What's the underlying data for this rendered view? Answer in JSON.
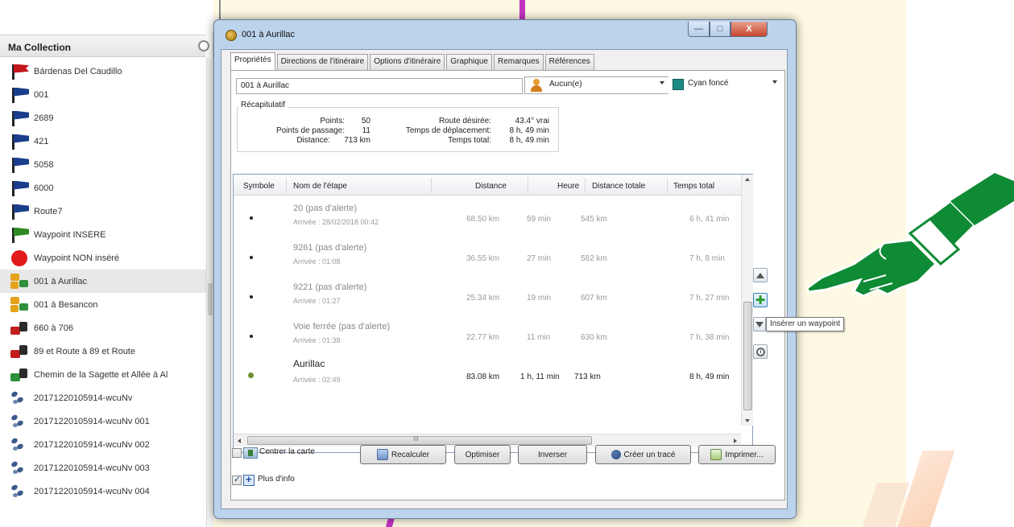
{
  "collection": {
    "header": "Ma Collection",
    "items": [
      {
        "label": "Bárdenas Del Caudillo",
        "icon": "red-flag-icon"
      },
      {
        "label": "001",
        "icon": "blue-flag-icon"
      },
      {
        "label": "2689",
        "icon": "blue-flag-icon"
      },
      {
        "label": "421",
        "icon": "blue-flag-icon"
      },
      {
        "label": "5058",
        "icon": "blue-flag-icon"
      },
      {
        "label": "6000",
        "icon": "blue-flag-icon"
      },
      {
        "label": "Route7",
        "icon": "blue-flag-icon"
      },
      {
        "label": "Waypoint INSERE",
        "icon": "green-flag-icon"
      },
      {
        "label": "Waypoint NON inséré",
        "icon": "red-dot-icon"
      },
      {
        "label": "001 à Aurillac",
        "icon": "route-yellow-icon"
      },
      {
        "label": "001 à Besancon",
        "icon": "route-yellow-icon"
      },
      {
        "label": "660 à 706",
        "icon": "route-red-icon"
      },
      {
        "label": "89 et Route à 89 et Route",
        "icon": "route-red-icon"
      },
      {
        "label": "Chemin de la Sagette et Allée à Al",
        "icon": "route-green-icon"
      },
      {
        "label": "20171220105914-wcuNv",
        "icon": "track-icon"
      },
      {
        "label": "20171220105914-wcuNv 001",
        "icon": "track-icon"
      },
      {
        "label": "20171220105914-wcuNv 002",
        "icon": "track-icon"
      },
      {
        "label": "20171220105914-wcuNv 003",
        "icon": "track-icon"
      },
      {
        "label": "20171220105914-wcuNv 004",
        "icon": "track-icon"
      }
    ]
  },
  "dialog": {
    "title": "001 à Aurillac",
    "window_controls": {
      "minimize": "—",
      "maximize": "□",
      "close": "X"
    },
    "tabs": [
      "Propriétés",
      "Directions de l'itinéraire",
      "Options d'itinéraire",
      "Graphique",
      "Remarques",
      "Références"
    ],
    "name_value": "001 à Aurillac",
    "assign_value": "Aucun(e)",
    "color_value": "Cyan foncé",
    "colors": {
      "accent": "#1c8a83"
    },
    "summary": {
      "title": "Récapitulatif",
      "points_label": "Points:",
      "points_value": "50",
      "waypoints_label": "Points de passage:",
      "waypoints_value": "11",
      "distance_label": "Distance:",
      "distance_value": "713 km",
      "route_label": "Route désirée:",
      "route_value": "43.4° vrai",
      "travel_label": "Temps de déplacement:",
      "travel_value": "8 h, 49 min",
      "total_label": "Temps total:",
      "total_value": "8 h, 49 min"
    },
    "table": {
      "headers": [
        "Symbole",
        "Nom de l'étape",
        "Distance",
        "Heure",
        "Distance totale",
        "Temps total"
      ],
      "rows": [
        {
          "name": "20 (pas d'alerte)",
          "arrival": "Arrivée : 28/02/2018 00:42",
          "distance": "68.50 km",
          "time": "59 min",
          "total_distance": "545 km",
          "total_time": "6 h, 41 min"
        },
        {
          "name": "9261 (pas d'alerte)",
          "arrival": "Arrivée : 01:08",
          "distance": "36.55 km",
          "time": "27 min",
          "total_distance": "582 km",
          "total_time": "7 h, 8 min"
        },
        {
          "name": "9221 (pas d'alerte)",
          "arrival": "Arrivée : 01:27",
          "distance": "25.34 km",
          "time": "19 min",
          "total_distance": "607 km",
          "total_time": "7 h, 27 min"
        },
        {
          "name": "Voie ferrée (pas d'alerte)",
          "arrival": "Arrivée : 01:38",
          "distance": "22.77 km",
          "time": "11 min",
          "total_distance": "630 km",
          "total_time": "7 h, 38 min"
        },
        {
          "name": "Aurillac",
          "arrival": "Arrivée : 02:49",
          "distance": "83.08 km",
          "time": "1 h, 11 min",
          "total_distance": "713 km",
          "total_time": "8 h, 49 min"
        }
      ]
    },
    "scroll_mid": "III",
    "tooltip": "Insérer un waypoint",
    "buttons": {
      "center_map": "Centrer la carte",
      "recalculate": "Recalculer",
      "optimize": "Optimiser",
      "reverse": "Inverser",
      "create_track": "Créer un tracé",
      "print": "Imprimer..."
    },
    "more_info": "Plus d'info"
  }
}
